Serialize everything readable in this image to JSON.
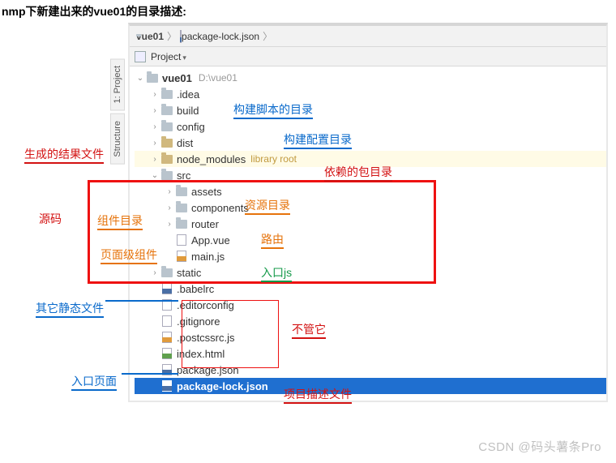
{
  "page_title": "nmp下新建出来的vue01的目录描述:",
  "crumb": {
    "root": "vue01",
    "file": "package-lock.json"
  },
  "toolbar": {
    "label": "Project"
  },
  "side_tabs": {
    "project": "1: Project",
    "structure": "Structure"
  },
  "tree": {
    "root": {
      "name": "vue01",
      "path": "D:\\vue01"
    },
    "idea": ".idea",
    "build": "build",
    "config": "config",
    "dist": "dist",
    "node_modules": "node_modules",
    "lib_root": "library root",
    "src": "src",
    "assets": "assets",
    "components": "components",
    "router": "router",
    "app_vue": "App.vue",
    "main_js": "main.js",
    "static": "static",
    "babelrc": ".babelrc",
    "editorconfig": ".editorconfig",
    "gitignore": ".gitignore",
    "postcssrc": ".postcssrc.js",
    "index_html": "index.html",
    "package_json": "package.json",
    "package_lock": "package-lock.json"
  },
  "anno": {
    "build": "构建脚本的目录",
    "config": "构建配置目录",
    "dist": "生成的结果文件",
    "node_modules": "依赖的包目录",
    "src_label": "源码",
    "assets": "资源目录",
    "components": "组件目录",
    "router": "路由",
    "app_vue": "页面级组件",
    "main_js": "入口js",
    "static": "其它静态文件",
    "ignore_group": "不管它",
    "index_html": "入口页面",
    "package_json": "项目描述文件"
  },
  "watermark": "CSDN @码头薯条Pro"
}
